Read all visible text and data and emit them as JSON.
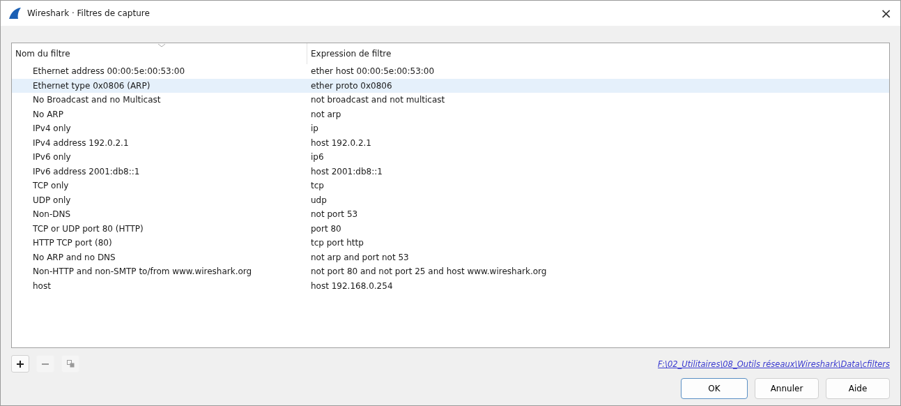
{
  "window": {
    "title": "Wireshark · Filtres de capture",
    "close": "×"
  },
  "table": {
    "columns": [
      {
        "label": "Nom du filtre",
        "sorted": true
      },
      {
        "label": "Expression de filtre",
        "sorted": false
      }
    ],
    "rows": [
      {
        "name": "Ethernet address 00:00:5e:00:53:00",
        "expression": "ether host 00:00:5e:00:53:00",
        "selected": false
      },
      {
        "name": "Ethernet type 0x0806 (ARP)",
        "expression": "ether proto 0x0806",
        "selected": true
      },
      {
        "name": "No Broadcast and no Multicast",
        "expression": "not broadcast and not multicast",
        "selected": false
      },
      {
        "name": "No ARP",
        "expression": "not arp",
        "selected": false
      },
      {
        "name": "IPv4 only",
        "expression": "ip",
        "selected": false
      },
      {
        "name": "IPv4 address 192.0.2.1",
        "expression": "host 192.0.2.1",
        "selected": false
      },
      {
        "name": "IPv6 only",
        "expression": "ip6",
        "selected": false
      },
      {
        "name": "IPv6 address 2001:db8::1",
        "expression": "host 2001:db8::1",
        "selected": false
      },
      {
        "name": "TCP only",
        "expression": "tcp",
        "selected": false
      },
      {
        "name": "UDP only",
        "expression": "udp",
        "selected": false
      },
      {
        "name": "Non-DNS",
        "expression": "not port 53",
        "selected": false
      },
      {
        "name": "TCP or UDP port 80 (HTTP)",
        "expression": "port 80",
        "selected": false
      },
      {
        "name": "HTTP TCP port (80)",
        "expression": "tcp port http",
        "selected": false
      },
      {
        "name": "No ARP and no DNS",
        "expression": "not arp and port not 53",
        "selected": false
      },
      {
        "name": "Non-HTTP and non-SMTP to/from www.wireshark.org",
        "expression": "not port 80 and not port 25 and host www.wireshark.org",
        "selected": false
      },
      {
        "name": "host",
        "expression": "host 192.168.0.254",
        "selected": false
      }
    ]
  },
  "toolbar": [
    {
      "kind": "add",
      "disabled": false
    },
    {
      "kind": "remove",
      "disabled": true
    },
    {
      "kind": "copy",
      "disabled": true
    }
  ],
  "file_link": "F:\\02_Utilitaires\\08_Outils réseaux\\Wireshark\\Data\\cfilters",
  "buttons": [
    {
      "label": "OK",
      "default": true
    },
    {
      "label": "Annuler",
      "default": false
    },
    {
      "label": "Aide",
      "default": false
    }
  ]
}
